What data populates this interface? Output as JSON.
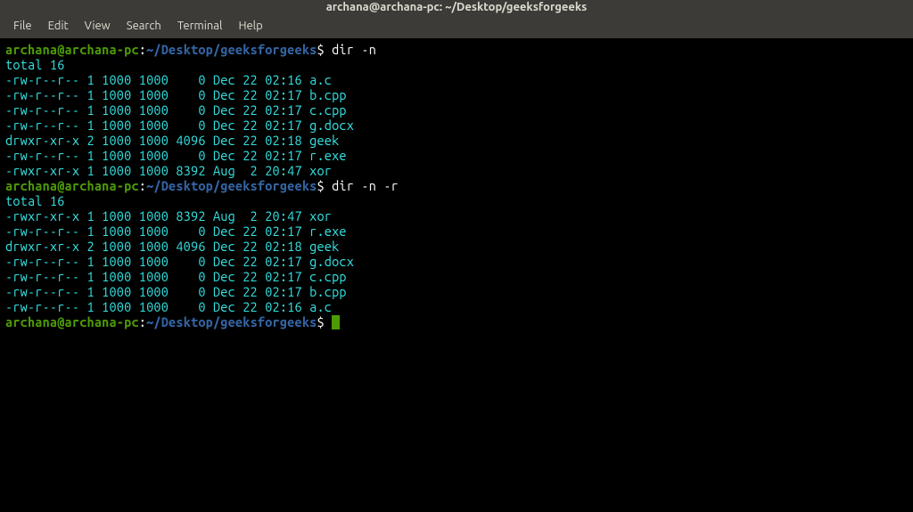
{
  "window": {
    "title": "archana@archana-pc: ~/Desktop/geeksforgeeks"
  },
  "menu": {
    "items": [
      "File",
      "Edit",
      "View",
      "Search",
      "Terminal",
      "Help"
    ]
  },
  "blocks": [
    {
      "prompt": {
        "userhost": "archana@archana-pc",
        "path": "~/Desktop/geeksforgeeks",
        "command": "dir -n"
      },
      "output": [
        "total 16",
        "-rw-r--r-- 1 1000 1000    0 Dec 22 02:16 a.c",
        "-rw-r--r-- 1 1000 1000    0 Dec 22 02:17 b.cpp",
        "-rw-r--r-- 1 1000 1000    0 Dec 22 02:17 c.cpp",
        "-rw-r--r-- 1 1000 1000    0 Dec 22 02:17 g.docx",
        "drwxr-xr-x 2 1000 1000 4096 Dec 22 02:18 geek",
        "-rw-r--r-- 1 1000 1000    0 Dec 22 02:17 r.exe",
        "-rwxr-xr-x 1 1000 1000 8392 Aug  2 20:47 xor"
      ]
    },
    {
      "prompt": {
        "userhost": "archana@archana-pc",
        "path": "~/Desktop/geeksforgeeks",
        "command": "dir -n -r"
      },
      "output": [
        "total 16",
        "-rwxr-xr-x 1 1000 1000 8392 Aug  2 20:47 xor",
        "-rw-r--r-- 1 1000 1000    0 Dec 22 02:17 r.exe",
        "drwxr-xr-x 2 1000 1000 4096 Dec 22 02:18 geek",
        "-rw-r--r-- 1 1000 1000    0 Dec 22 02:17 g.docx",
        "-rw-r--r-- 1 1000 1000    0 Dec 22 02:17 c.cpp",
        "-rw-r--r-- 1 1000 1000    0 Dec 22 02:17 b.cpp",
        "-rw-r--r-- 1 1000 1000    0 Dec 22 02:16 a.c"
      ]
    }
  ],
  "finalPrompt": {
    "userhost": "archana@archana-pc",
    "path": "~/Desktop/geeksforgeeks"
  }
}
